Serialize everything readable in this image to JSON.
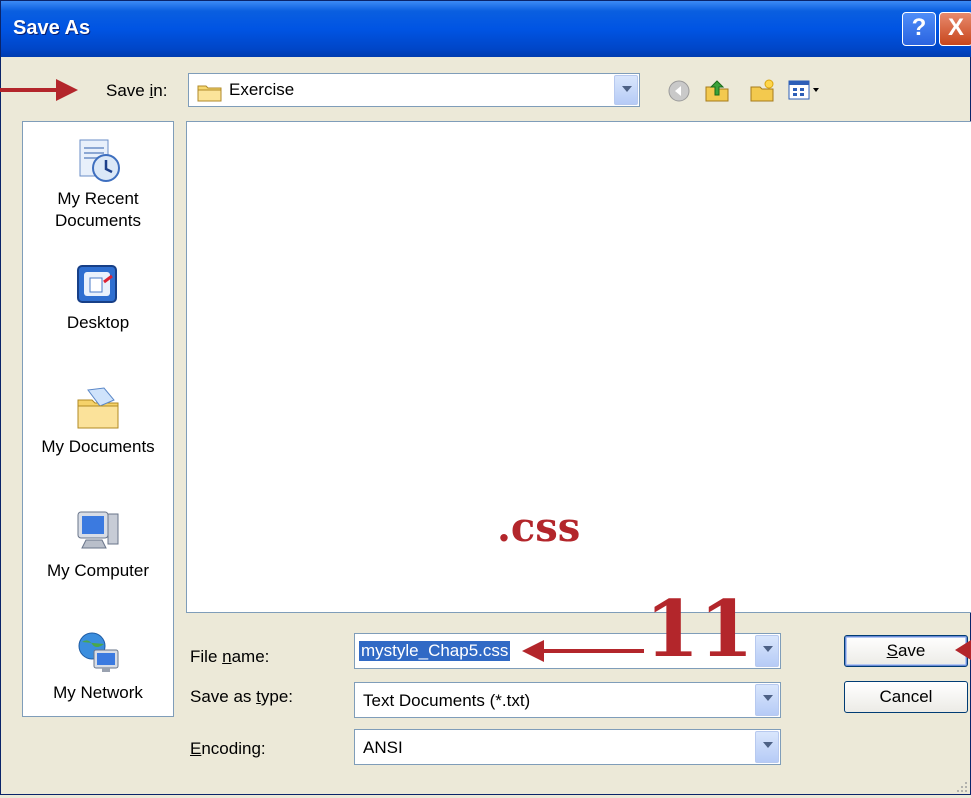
{
  "window": {
    "title": "Save As"
  },
  "title_buttons": {
    "help": "?",
    "close": "X"
  },
  "toolbar": {
    "save_in_label_pre": "Save ",
    "save_in_label_u": "i",
    "save_in_label_post": "n:",
    "save_in_value": "Exercise",
    "icons": [
      "back-icon",
      "up-folder-icon",
      "new-folder-icon",
      "views-menu-icon"
    ]
  },
  "places": [
    {
      "label": "My Recent\nDocuments",
      "icon": "recent-documents-icon"
    },
    {
      "label": "Desktop",
      "icon": "desktop-icon"
    },
    {
      "label": "My Documents",
      "icon": "my-documents-icon"
    },
    {
      "label": "My Computer",
      "icon": "my-computer-icon"
    },
    {
      "label": "My Network",
      "icon": "my-network-icon"
    }
  ],
  "form": {
    "file_name_label_pre": "File ",
    "file_name_label_u": "n",
    "file_name_label_post": "ame:",
    "file_name_value": "mystyle_Chap5.css",
    "save_type_label_pre": "Save as ",
    "save_type_label_u": "t",
    "save_type_label_post": "ype:",
    "save_type_value": "Text Documents (*.txt)",
    "encoding_label_u": "E",
    "encoding_label_post": "ncoding:",
    "encoding_value": "ANSI"
  },
  "buttons": {
    "save_u": "S",
    "save_post": "ave",
    "cancel": "Cancel"
  },
  "annotations": {
    "extension_note": ".css",
    "step_number": "11",
    "color": "#b3262b"
  }
}
